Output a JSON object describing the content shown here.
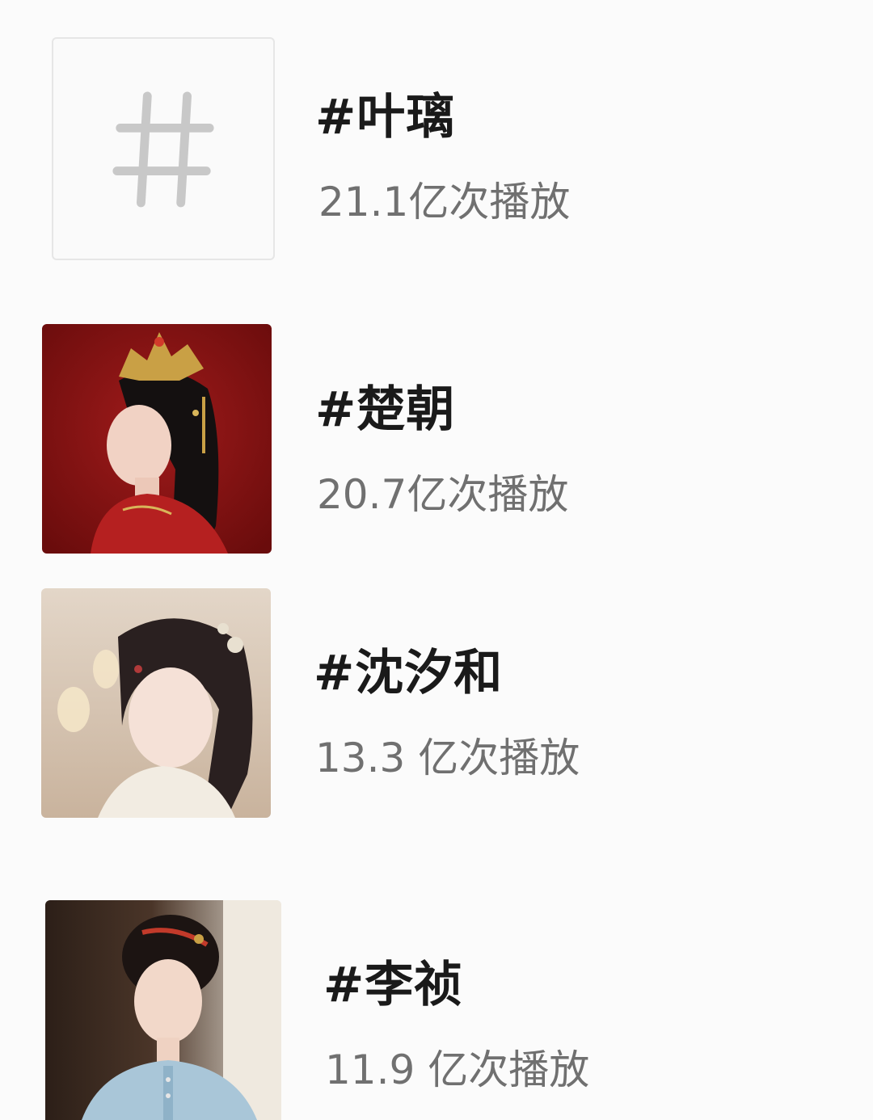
{
  "topics": [
    {
      "title": "#叶璃",
      "count": "21.1亿次播放",
      "thumb_icon": "hashtag-icon"
    },
    {
      "title": "#楚朝",
      "count": "20.7亿次播放",
      "thumb_icon": "portrait-red-costume"
    },
    {
      "title": "#沈汐和",
      "count": "13.3 亿次播放",
      "thumb_icon": "portrait-white-costume"
    },
    {
      "title": "#李祯",
      "count": "11.9 亿次播放",
      "thumb_icon": "portrait-blue-costume"
    }
  ],
  "colors": {
    "background": "#fbfbfb",
    "title": "#1a1a1a",
    "count": "#707070",
    "hash_icon": "#c8c8c8",
    "thumb_red": "#8e1414",
    "thumb_cream": "#d8cbbd",
    "thumb_dark": "#3a2a22"
  }
}
